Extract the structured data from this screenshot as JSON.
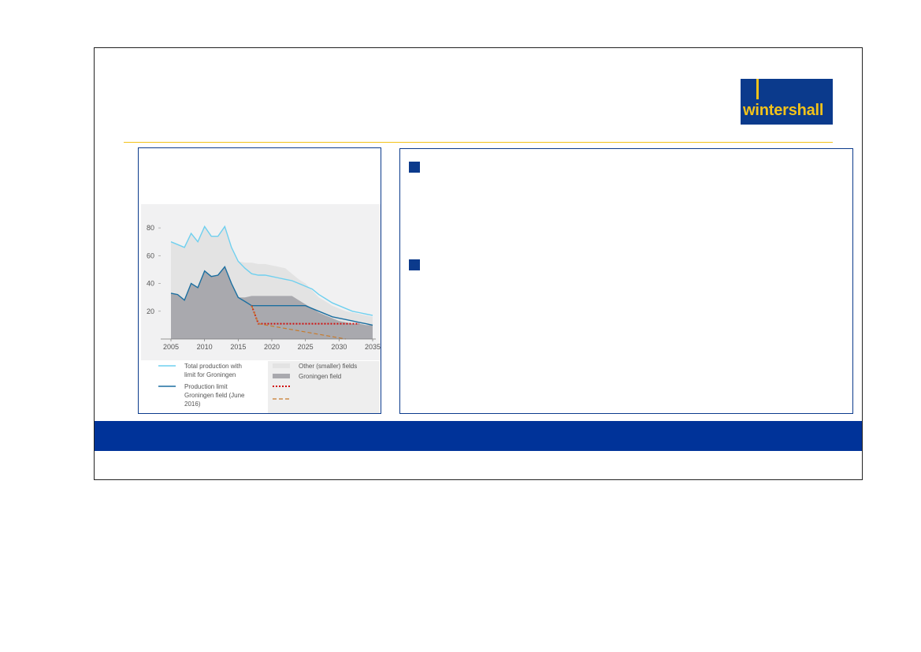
{
  "logo": {
    "text": "wintershall"
  },
  "colors": {
    "brand_blue": "#003399",
    "brand_yellow": "#f2c21a",
    "total_line": "#6fd0ef",
    "limit_line": "#1c6fa0",
    "other_fields_area": "#e3e3e3",
    "groningen_area": "#a9a9ae",
    "new_limit": "#d01010",
    "alt_limit": "#c87a2a"
  },
  "chart_data": {
    "type": "area",
    "x": [
      2005,
      2006,
      2007,
      2008,
      2009,
      2010,
      2011,
      2012,
      2013,
      2014,
      2015,
      2016,
      2017,
      2018,
      2019,
      2020,
      2021,
      2022,
      2023,
      2024,
      2025,
      2026,
      2027,
      2028,
      2029,
      2030,
      2031,
      2032,
      2033,
      2034,
      2035
    ],
    "xticks": [
      "2005",
      "2010",
      "2015",
      "2020",
      "2025",
      "2030",
      "2035"
    ],
    "yticks": [
      "20",
      "40",
      "60",
      "80"
    ],
    "xlim": [
      2005,
      2035
    ],
    "ylim": [
      0,
      88
    ],
    "series": [
      {
        "name": "Other (smaller) fields",
        "kind": "area",
        "values": [
          70,
          68,
          66,
          76,
          70,
          81,
          74,
          74,
          81,
          66,
          56,
          55,
          55,
          54,
          54,
          53,
          52,
          51,
          47,
          43,
          40,
          35,
          30,
          27,
          24,
          22,
          20,
          19,
          18,
          17,
          16
        ]
      },
      {
        "name": "Groningen field",
        "kind": "area",
        "values": [
          33,
          32,
          28,
          40,
          37,
          49,
          45,
          46,
          52,
          40,
          30,
          30,
          31,
          31,
          31,
          31,
          31,
          31,
          31,
          28,
          25,
          22,
          19,
          17,
          15,
          13,
          12,
          11,
          11,
          10,
          10
        ]
      },
      {
        "name": "Total production with limit for Groningen",
        "kind": "line",
        "values": [
          70,
          68,
          66,
          76,
          70,
          81,
          74,
          74,
          81,
          66,
          56,
          51,
          47,
          46,
          46,
          45,
          44,
          43,
          42,
          40,
          38,
          36,
          32,
          29,
          26,
          24,
          22,
          20,
          19,
          18,
          17
        ]
      },
      {
        "name": "Production limit Groningen field (June 2016)",
        "kind": "line",
        "values": [
          33,
          32,
          28,
          40,
          37,
          49,
          45,
          46,
          52,
          40,
          30,
          27,
          24,
          24,
          24,
          24,
          24,
          24,
          24,
          24,
          24,
          22,
          20,
          18,
          16,
          15,
          14,
          13,
          12,
          11,
          10
        ]
      },
      {
        "kind": "dotted-line",
        "x": [
          2017,
          2018,
          2033
        ],
        "values": [
          24,
          11,
          11
        ]
      },
      {
        "kind": "dashed-line",
        "x": [
          2017,
          2018,
          2031
        ],
        "values": [
          24,
          11,
          0
        ]
      }
    ],
    "legend": [
      {
        "label": "Total production with limit for Groningen",
        "symbol": "line",
        "color": "#6fd0ef"
      },
      {
        "label": "Production limit Groningen field (June 2016)",
        "symbol": "line",
        "color": "#1c6fa0"
      },
      {
        "label": "Other (smaller) fields",
        "symbol": "box",
        "color": "#e3e3e3"
      },
      {
        "label": "Groningen field",
        "symbol": "box",
        "color": "#a9a9ae"
      },
      {
        "label": "",
        "symbol": "dotted",
        "color": "#d01010"
      },
      {
        "label": "",
        "symbol": "dashed",
        "color": "#c87a2a"
      }
    ],
    "legend_placement": "bottom",
    "grid": false
  }
}
